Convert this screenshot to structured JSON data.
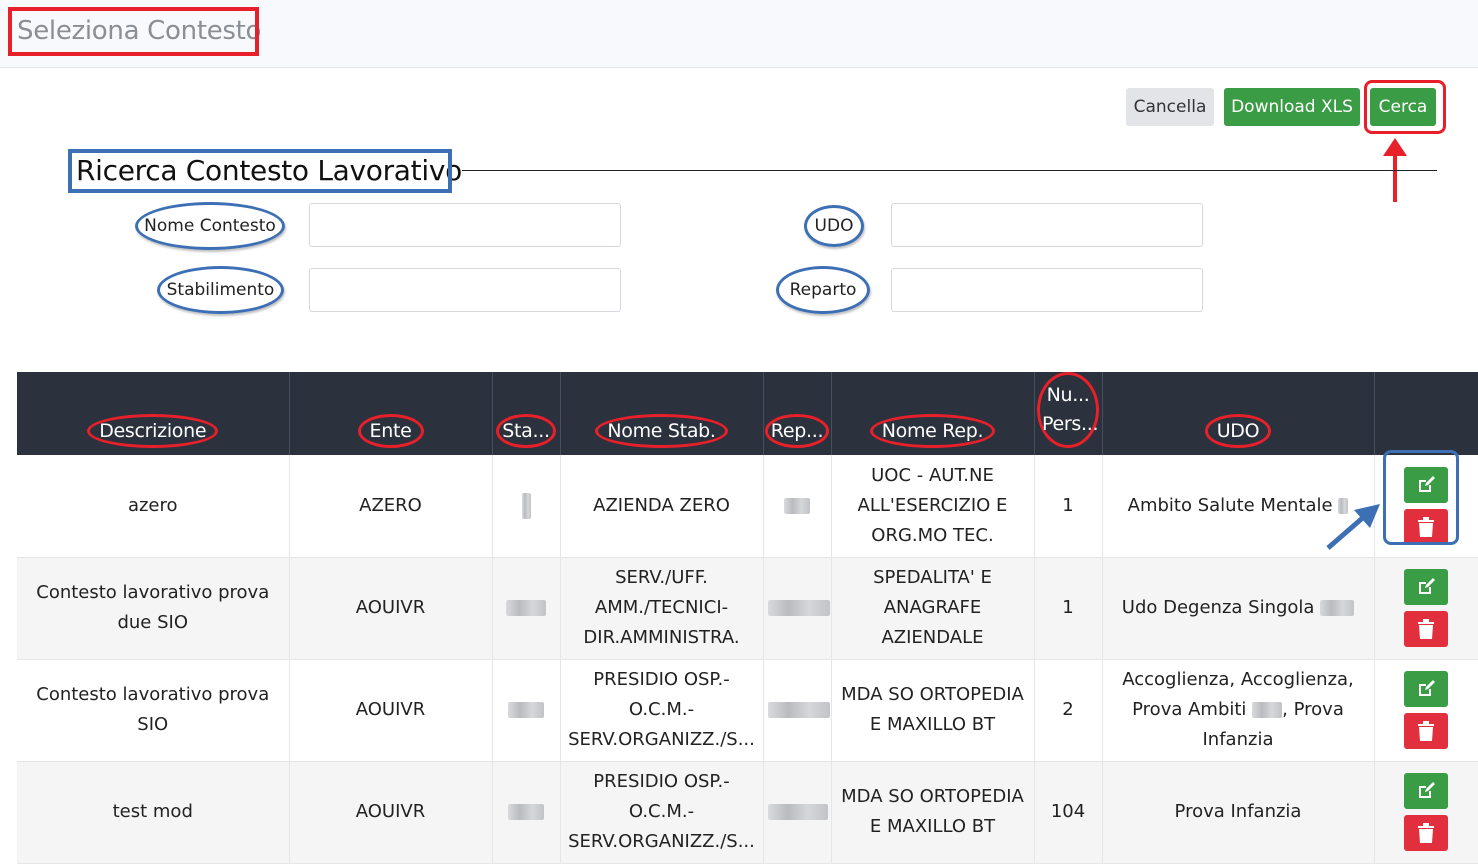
{
  "header": {
    "title": "Seleziona Contesto"
  },
  "toolbar": {
    "cancel_label": "Cancella",
    "download_label": "Download XLS",
    "search_label": "Cerca"
  },
  "section": {
    "title": "Ricerca Contesto Lavorativo"
  },
  "filters": {
    "nome_contesto_label": "Nome Contesto",
    "udo_label": "UDO",
    "stabilimento_label": "Stabilimento",
    "reparto_label": "Reparto"
  },
  "table": {
    "columns": [
      "Descrizione",
      "Ente",
      "Sta...",
      "Nome Stab.",
      "Rep...",
      "Nome Rep.",
      "Nu... Pers...",
      "UDO",
      ""
    ],
    "rows": [
      {
        "descrizione": "azero",
        "ente": "AZERO",
        "nome_stab": "AZIENDA ZERO",
        "nome_rep": "UOC - AUT.NE ALL'ESERCIZIO E ORG.MO TEC.",
        "num_pers": "1",
        "udo": "Ambito Salute Mentale"
      },
      {
        "descrizione": "Contesto lavorativo prova due SIO",
        "ente": "AOUIVR",
        "nome_stab": "SERV./UFF. AMM./TECNICI-DIR.AMMINISTRA.",
        "nome_rep": "SPEDALITA' E ANAGRAFE AZIENDALE",
        "num_pers": "1",
        "udo": "Udo Degenza Singola"
      },
      {
        "descrizione": "Contesto lavorativo prova SIO",
        "ente": "AOUIVR",
        "nome_stab": "PRESIDIO OSP.-O.C.M.-SERV.ORGANIZZ./S...",
        "nome_rep": "MDA SO ORTOPEDIA E MAXILLO BT",
        "num_pers": "2",
        "udo_a": "Accoglienza, Accoglienza, Prova Ambiti",
        "udo_b": ", Prova Infanzia"
      },
      {
        "descrizione": "test mod",
        "ente": "AOUIVR",
        "nome_stab": "PRESIDIO OSP.-O.C.M.-SERV.ORGANIZZ./S...",
        "nome_rep": "MDA SO ORTOPEDIA E MAXILLO BT",
        "num_pers": "104",
        "udo": "Prova Infanzia"
      }
    ]
  },
  "icons": {
    "edit": "edit-icon",
    "delete": "trash-icon"
  },
  "colors": {
    "accent_green": "#3a9c44",
    "danger_red": "#e22f3e",
    "header_dark": "#2b313d",
    "annotation_red": "#e8202a",
    "annotation_blue": "#3d6fb5"
  }
}
